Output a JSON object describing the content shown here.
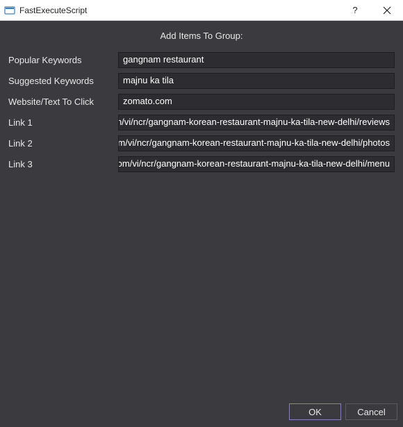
{
  "titlebar": {
    "title": "FastExecuteScript",
    "help": "?",
    "close": "×"
  },
  "heading": "Add Items To Group:",
  "fields": [
    {
      "label": "Popular Keywords",
      "value": "gangnam restaurant",
      "truncated": false
    },
    {
      "label": "Suggested Keywords",
      "value": "majnu ka tila",
      "truncated": false
    },
    {
      "label": "Website/Text To Click",
      "value": "zomato.com",
      "truncated": false
    },
    {
      "label": "Link 1",
      "value": "om/vi/ncr/gangnam-korean-restaurant-majnu-ka-tila-new-delhi/reviews",
      "truncated": true
    },
    {
      "label": "Link 2",
      "value": ":om/vi/ncr/gangnam-korean-restaurant-majnu-ka-tila-new-delhi/photos",
      "truncated": true
    },
    {
      "label": "Link 3",
      "value": ".com/vi/ncr/gangnam-korean-restaurant-majnu-ka-tila-new-delhi/menu",
      "truncated": true
    }
  ],
  "buttons": {
    "ok": "OK",
    "cancel": "Cancel"
  }
}
